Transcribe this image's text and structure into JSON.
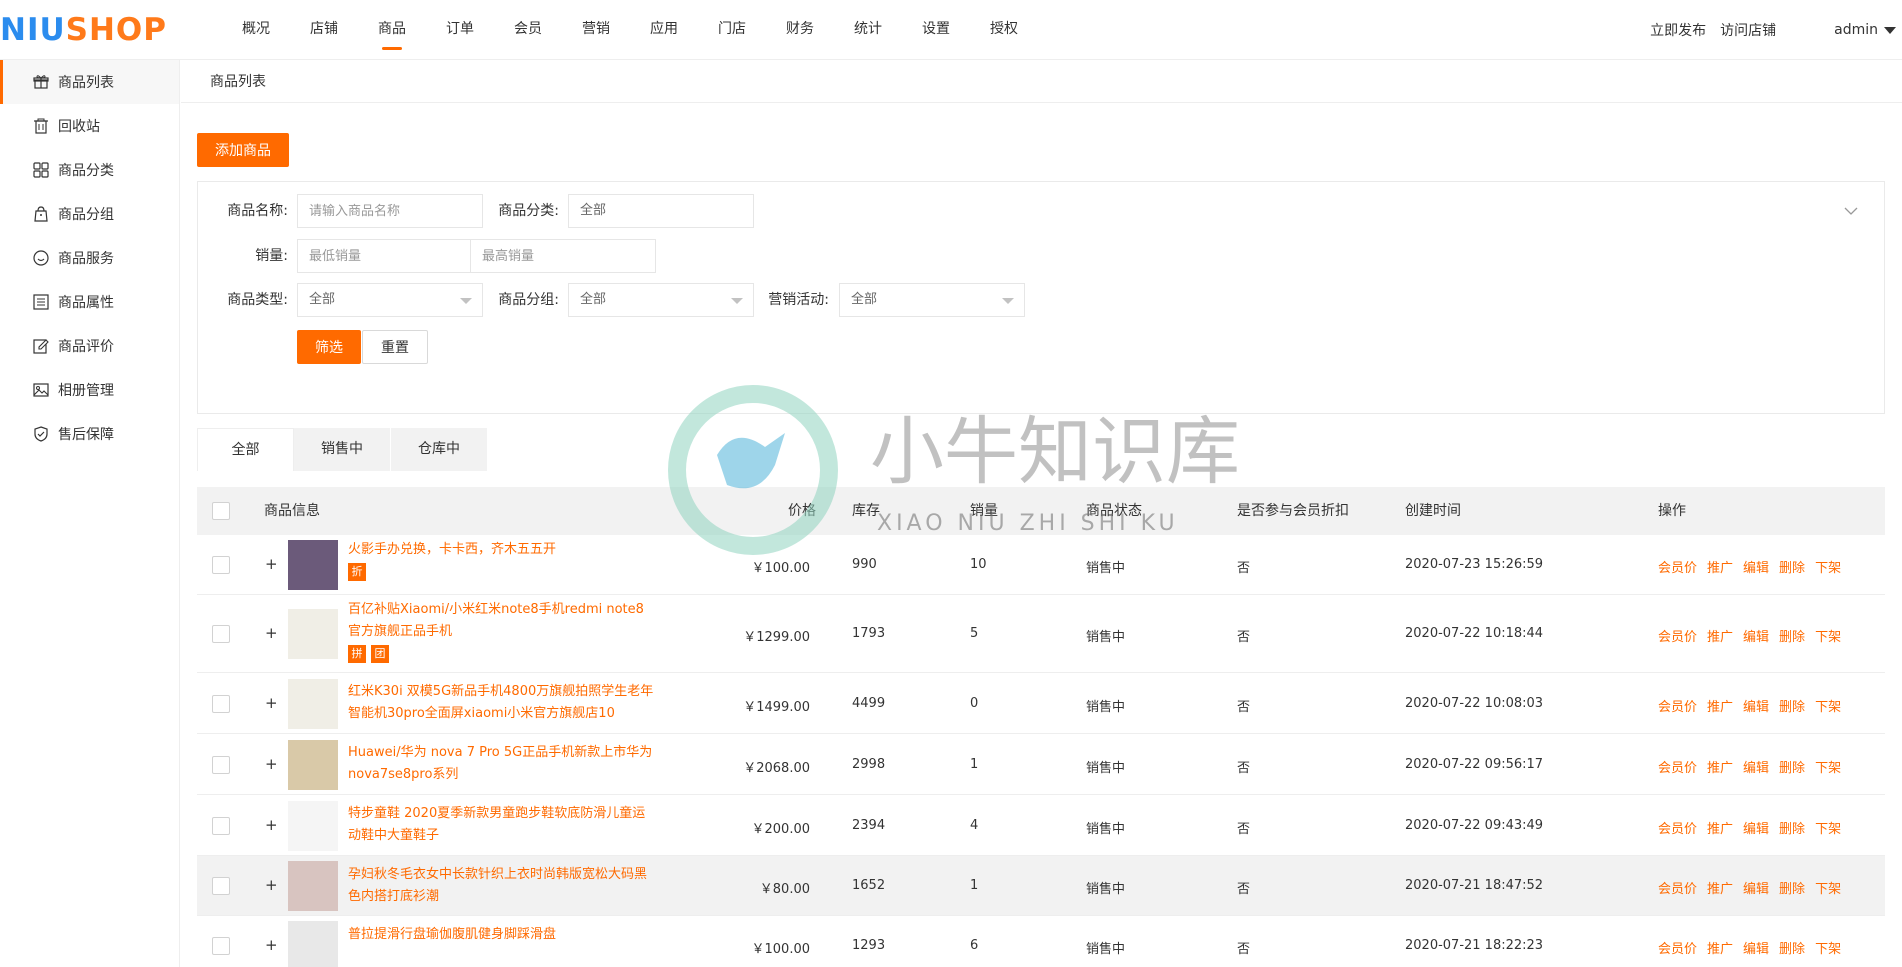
{
  "brand": {
    "logo_part1": "NIU",
    "logo_part2": "SHOP"
  },
  "topnav": [
    {
      "label": "概况",
      "active": false
    },
    {
      "label": "店铺",
      "active": false
    },
    {
      "label": "商品",
      "active": true
    },
    {
      "label": "订单",
      "active": false
    },
    {
      "label": "会员",
      "active": false
    },
    {
      "label": "营销",
      "active": false
    },
    {
      "label": "应用",
      "active": false
    },
    {
      "label": "门店",
      "active": false
    },
    {
      "label": "财务",
      "active": false
    },
    {
      "label": "统计",
      "active": false
    },
    {
      "label": "设置",
      "active": false
    },
    {
      "label": "授权",
      "active": false
    }
  ],
  "header": {
    "publish": "立即发布",
    "visit": "访问店铺",
    "user": "admin"
  },
  "sidebar": [
    {
      "label": "商品列表",
      "icon": "gift-icon",
      "active": true
    },
    {
      "label": "回收站",
      "icon": "trash-icon",
      "active": false
    },
    {
      "label": "商品分类",
      "icon": "grid-icon",
      "active": false
    },
    {
      "label": "商品分组",
      "icon": "bag-icon",
      "active": false
    },
    {
      "label": "商品服务",
      "icon": "smile-icon",
      "active": false
    },
    {
      "label": "商品属性",
      "icon": "list-icon",
      "active": false
    },
    {
      "label": "商品评价",
      "icon": "edit-icon",
      "active": false
    },
    {
      "label": "相册管理",
      "icon": "image-icon",
      "active": false
    },
    {
      "label": "售后保障",
      "icon": "shield-icon",
      "active": false
    }
  ],
  "breadcrumb": "商品列表",
  "add_button": "添加商品",
  "filter": {
    "name_label": "商品名称:",
    "name_placeholder": "请输入商品名称",
    "category_label": "商品分类:",
    "category_value": "全部",
    "sales_label": "销量:",
    "sales_min_placeholder": "最低销量",
    "sales_sep": "-",
    "sales_max_placeholder": "最高销量",
    "type_label": "商品类型:",
    "type_value": "全部",
    "group_label": "商品分组:",
    "group_value": "全部",
    "promo_label": "营销活动:",
    "promo_value": "全部",
    "filter_button": "筛选",
    "reset_button": "重置"
  },
  "tabs": [
    {
      "label": "全部",
      "active": true
    },
    {
      "label": "销售中",
      "active": false
    },
    {
      "label": "仓库中",
      "active": false
    }
  ],
  "table": {
    "headers": {
      "info": "商品信息",
      "price": "价格",
      "stock": "库存",
      "sales": "销量",
      "status": "商品状态",
      "member_discount": "是否参与会员折扣",
      "created": "创建时间",
      "ops": "操作"
    },
    "op_labels": [
      "会员价",
      "推广",
      "编辑",
      "删除",
      "下架"
    ],
    "rows": [
      {
        "name": "火影手办兑换，卡卡西，齐木五五开",
        "tags": [
          "折"
        ],
        "price": "￥100.00",
        "stock": "990",
        "sales": "10",
        "status": "销售中",
        "discount": "否",
        "created": "2020-07-23 15:26:59",
        "thumb_color": "#6b5a7a"
      },
      {
        "name": "百亿补贴Xiaomi/小米红米note8手机redmi note8官方旗舰正品手机",
        "tags": [
          "拼",
          "团"
        ],
        "price": "￥1299.00",
        "stock": "1793",
        "sales": "5",
        "status": "销售中",
        "discount": "否",
        "created": "2020-07-22 10:18:44",
        "thumb_color": "#f0eee6"
      },
      {
        "name": "红米K30i 双模5G新品手机4800万旗舰拍照学生老年智能机30pro全面屏xiaomi小米官方旗舰店10",
        "tags": [],
        "price": "￥1499.00",
        "stock": "4499",
        "sales": "0",
        "status": "销售中",
        "discount": "否",
        "created": "2020-07-22 10:08:03",
        "thumb_color": "#f0eee6"
      },
      {
        "name": "Huawei/华为 nova 7 Pro 5G正品手机新款上市华为nova7se8pro系列",
        "tags": [],
        "price": "￥2068.00",
        "stock": "2998",
        "sales": "1",
        "status": "销售中",
        "discount": "否",
        "created": "2020-07-22 09:56:17",
        "thumb_color": "#d9c9a8"
      },
      {
        "name": "特步童鞋 2020夏季新款男童跑步鞋软底防滑儿童运动鞋中大童鞋子",
        "tags": [],
        "price": "￥200.00",
        "stock": "2394",
        "sales": "4",
        "status": "销售中",
        "discount": "否",
        "created": "2020-07-22 09:43:49",
        "thumb_color": "#f5f5f5"
      },
      {
        "name": "孕妇秋冬毛衣女中长款针织上衣时尚韩版宽松大码黑色内搭打底衫潮",
        "tags": [],
        "price": "￥80.00",
        "stock": "1652",
        "sales": "1",
        "status": "销售中",
        "discount": "否",
        "created": "2020-07-21 18:47:52",
        "thumb_color": "#d8c4c0"
      },
      {
        "name": "普拉提滑行盘瑜伽腹肌健身脚踩滑盘",
        "tags": [],
        "price": "￥100.00",
        "stock": "1293",
        "sales": "6",
        "status": "销售中",
        "discount": "否",
        "created": "2020-07-21 18:22:23",
        "thumb_color": "#e8e8e8"
      }
    ]
  },
  "watermark": {
    "title": "小牛知识库",
    "subtitle": "XIAO NIU ZHI SHI KU"
  },
  "colors": {
    "accent": "#ff6a00",
    "logo_blue": "#2b8cee",
    "logo_orange": "#ff7a1a"
  }
}
